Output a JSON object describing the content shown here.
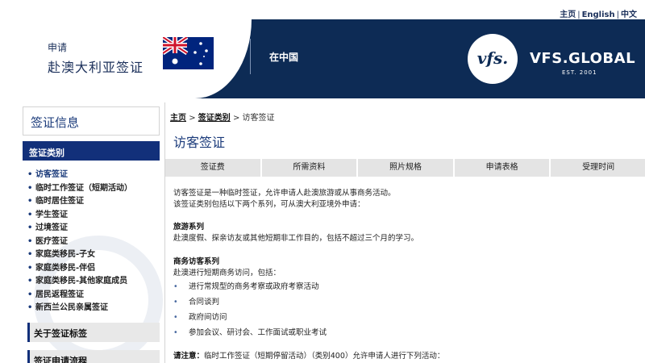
{
  "top_links": {
    "home": "主页",
    "english": "English",
    "chinese": "中文"
  },
  "banner": {
    "subtitle": "申请",
    "title": "赴澳大利亚签证",
    "country": "在中国",
    "logo_text": "vfs.",
    "brand_name": "VFS.GLOBAL",
    "brand_est": "EST. 2001"
  },
  "sidebar": {
    "heading": "签证信息",
    "category_header": "签证类别",
    "items": [
      "访客签证",
      "临时工作签证（短期活动）",
      "临时居住签证",
      "学生签证",
      "过境签证",
      "医疗签证",
      "家庭类移民-子女",
      "家庭类移民-伴侣",
      "家庭类移民-其他家庭成员",
      "居民返程签证",
      "新西兰公民亲属签证"
    ],
    "active_index": 0,
    "link_label_1": "关于签证标签",
    "link_label_2": "签证申请流程"
  },
  "content": {
    "breadcrumb": {
      "home": "主页",
      "sep": ">",
      "category": "签证类别",
      "current": "访客签证"
    },
    "title": "访客签证",
    "tabs": [
      "签证费",
      "所需资料",
      "照片规格",
      "申请表格",
      "受理时间"
    ],
    "intro_line1": "访客签证是一种临时签证，允许申请人赴澳旅游或从事商务活动。",
    "intro_line2": "该签证类别包括以下两个系列，可从澳大利亚境外申请：",
    "tourist_title": "旅游系列",
    "tourist_desc": "赴澳度假、探亲访友或其他短期非工作目的，包括不超过三个月的学习。",
    "business_title": "商务访客系列",
    "business_desc": "赴澳进行短期商务访问，包括：",
    "bullets": [
      "进行常规型的商务考察或政府考察活动",
      "合同谈判",
      "政府间访问",
      "参加会议、研讨会、工作面试或职业考试"
    ],
    "note_label": "请注意：",
    "note_text": "临时工作签证（短期停留活动）（类别400）允许申请人进行下列活动："
  },
  "colors": {
    "navy": "#0d2b55",
    "accent_blue": "#12307a",
    "tab_gray": "#e4e4e4"
  },
  "icons": {
    "bullet": "•",
    "flag": "australia-flag-icon",
    "logo": "vfs-logo-icon"
  }
}
